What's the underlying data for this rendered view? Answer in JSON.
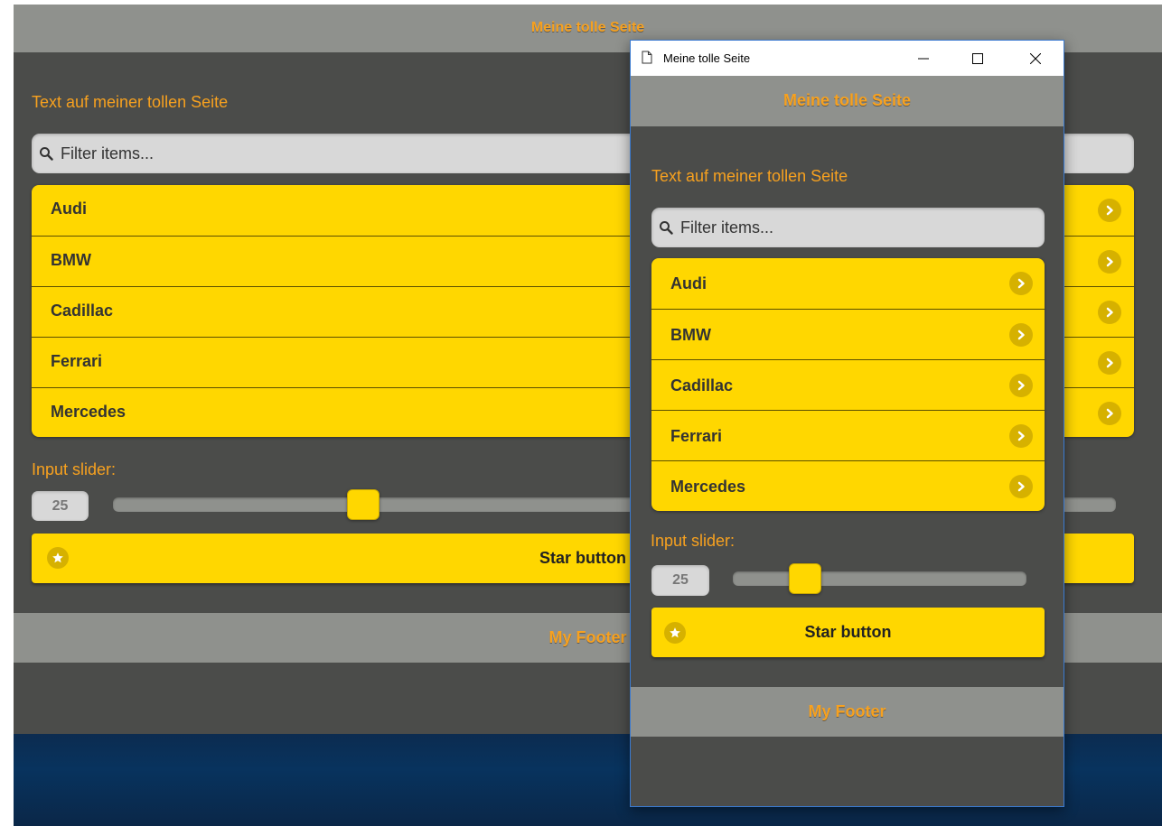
{
  "colors": {
    "accent": "#f7a11f",
    "brand_yellow": "#ffd700",
    "page_bg": "#4b4c4a",
    "bar_gray": "#8f918d",
    "window_border": "#3a7ad0"
  },
  "background_page": {
    "header_title": "Meine tolle Seite",
    "intro_text": "Text auf meiner tollen Seite",
    "search": {
      "placeholder": "Filter items...",
      "icon": "search-icon"
    },
    "list_items": [
      {
        "label": "Audi"
      },
      {
        "label": "BMW"
      },
      {
        "label": "Cadillac"
      },
      {
        "label": "Ferrari"
      },
      {
        "label": "Mercedes"
      }
    ],
    "slider": {
      "label": "Input slider:",
      "value": "25",
      "value_fraction": 0.25
    },
    "star_button_label": "Star button",
    "footer_text": "My Footer"
  },
  "window": {
    "title": "Meine tolle Seite",
    "controls": [
      "minimize-icon",
      "maximize-icon",
      "close-icon"
    ],
    "page": {
      "header_title": "Meine tolle Seite",
      "intro_text": "Text auf meiner tollen Seite",
      "search": {
        "placeholder": "Filter items...",
        "icon": "search-icon"
      },
      "list_items": [
        {
          "label": "Audi"
        },
        {
          "label": "BMW"
        },
        {
          "label": "Cadillac"
        },
        {
          "label": "Ferrari"
        },
        {
          "label": "Mercedes"
        }
      ],
      "slider": {
        "label": "Input slider:",
        "value": "25",
        "value_fraction": 0.25
      },
      "star_button_label": "Star button",
      "footer_text": "My Footer"
    }
  }
}
